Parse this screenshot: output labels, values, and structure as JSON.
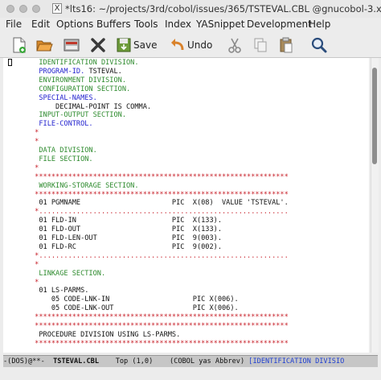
{
  "window": {
    "title": "*lts16: ~/projects/3rd/cobol/issues/365/TSTEVAL.CBL @gnucobol-3.x",
    "x_badge": "X"
  },
  "menu": [
    "File",
    "Edit",
    "Options",
    "Buffers",
    "Tools",
    "Index",
    "YASnippet",
    "Development",
    "Help"
  ],
  "toolbar": {
    "save_label": "Save",
    "undo_label": "Undo"
  },
  "editor": {
    "lines": [
      {
        "text": "  IDENTIFICATION DIVISION.",
        "color": "#2e8b2e"
      },
      {
        "text": "  PROGRAM-ID. TSTEVAL.",
        "color": "#111111",
        "prefix": "  PROGRAM-ID.",
        "prefix_color": "#2323cf"
      },
      {
        "text": "  ENVIRONMENT DIVISION.",
        "color": "#2e8b2e"
      },
      {
        "text": "  CONFIGURATION SECTION.",
        "color": "#2e8b2e"
      },
      {
        "text": "  SPECIAL-NAMES.",
        "color": "#2323cf"
      },
      {
        "text": "      DECIMAL-POINT IS COMMA.",
        "color": "#111111"
      },
      {
        "text": "  INPUT-OUTPUT SECTION.",
        "color": "#2e8b2e"
      },
      {
        "text": "  FILE-CONTROL.",
        "color": "#2323cf"
      },
      {
        "text": " *",
        "color": "#c8232c"
      },
      {
        "text": " *",
        "color": "#c8232c"
      },
      {
        "text": "  DATA DIVISION.",
        "color": "#2e8b2e"
      },
      {
        "text": "  FILE SECTION.",
        "color": "#2e8b2e"
      },
      {
        "text": " *",
        "color": "#c8232c"
      },
      {
        "text": " *************************************************************",
        "color": "#c8232c"
      },
      {
        "text": "  WORKING-STORAGE SECTION.",
        "color": "#2e8b2e"
      },
      {
        "text": " *************************************************************",
        "color": "#c8232c"
      },
      {
        "text": "  01 PGMNAME                      PIC  X(08)  VALUE 'TSTEVAL'.",
        "color": "#111111"
      },
      {
        "text": " *............................................................",
        "color": "#c8232c"
      },
      {
        "text": "  01 FLD-IN                       PIC  X(133).",
        "color": "#111111"
      },
      {
        "text": "  01 FLD-OUT                      PIC  X(133).",
        "color": "#111111"
      },
      {
        "text": "  01 FLD-LEN-OUT                  PIC  9(003).",
        "color": "#111111"
      },
      {
        "text": "  01 FLD-RC                       PIC  9(002).",
        "color": "#111111"
      },
      {
        "text": " *............................................................",
        "color": "#c8232c"
      },
      {
        "text": " *",
        "color": "#c8232c"
      },
      {
        "text": "  LINKAGE SECTION.",
        "color": "#2e8b2e"
      },
      {
        "text": " *",
        "color": "#c8232c"
      },
      {
        "text": "  01 LS-PARMS.",
        "color": "#111111"
      },
      {
        "text": "     05 CODE-LNK-IN                    PIC X(006).",
        "color": "#111111"
      },
      {
        "text": "     05 CODE-LNK-OUT                   PIC X(006).",
        "color": "#111111"
      },
      {
        "text": " *************************************************************",
        "color": "#c8232c"
      },
      {
        "text": " *************************************************************",
        "color": "#c8232c"
      },
      {
        "text": "  PROCEDURE DIVISION USING LS-PARMS.",
        "color": "#111111"
      },
      {
        "text": " *************************************************************",
        "color": "#c8232c"
      }
    ]
  },
  "modeline": {
    "left": "-(DOS)@**-  ",
    "buffer": "TSTEVAL.CBL",
    "position": "    Top (1,0)    ",
    "modes": "(COBOL yas Abbrev) ",
    "func": "[IDENTIFICATION DIVISIO"
  }
}
